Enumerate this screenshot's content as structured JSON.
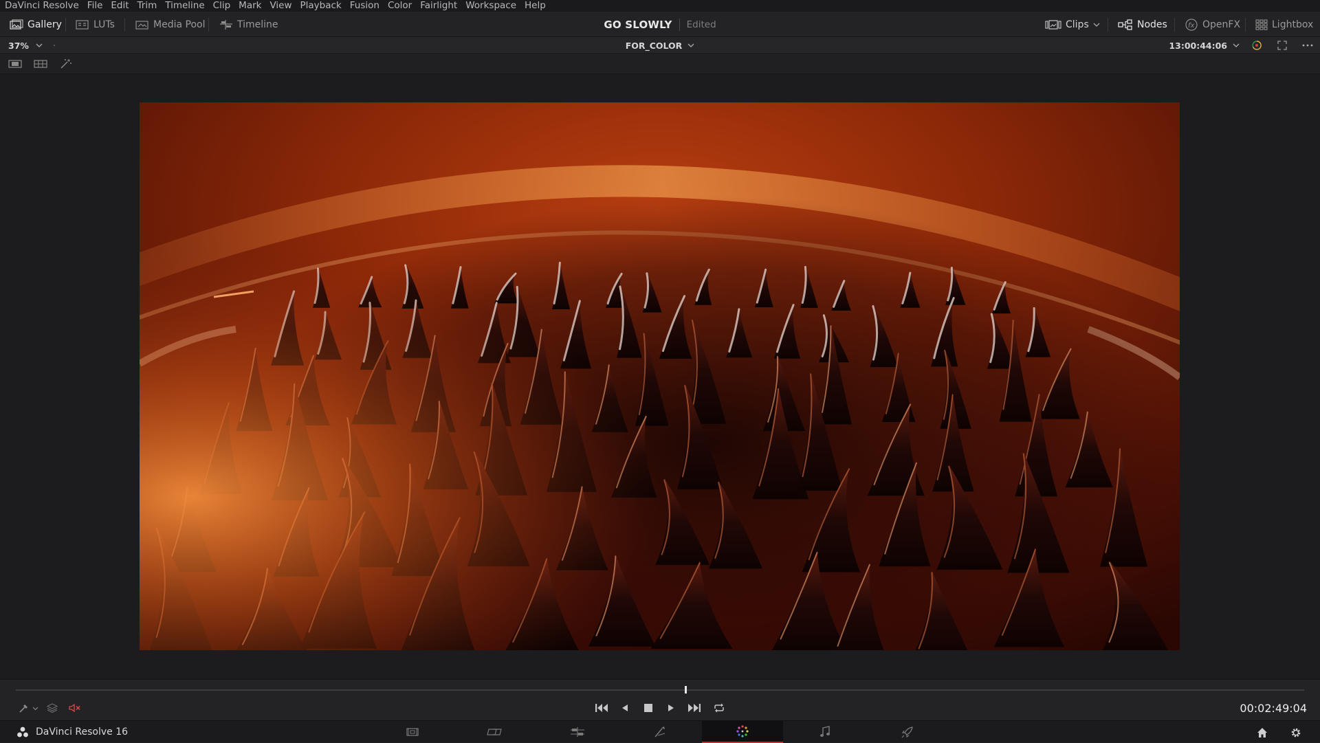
{
  "menu": [
    "DaVinci Resolve",
    "File",
    "Edit",
    "Trim",
    "Timeline",
    "Clip",
    "Mark",
    "View",
    "Playback",
    "Fusion",
    "Color",
    "Fairlight",
    "Workspace",
    "Help"
  ],
  "toolbar": {
    "gallery": "Gallery",
    "luts": "LUTs",
    "media_pool": "Media Pool",
    "timeline": "Timeline",
    "project_title": "GO SLOWLY",
    "project_status": "Edited",
    "clips": "Clips",
    "nodes": "Nodes",
    "openfx": "OpenFX",
    "lightbox": "Lightbox"
  },
  "viewer": {
    "zoom": "37%",
    "timeline_name": "FOR_COLOR",
    "timecode": "13:00:44:06",
    "playhead_fraction": 0.52
  },
  "transport": {
    "timecode": "00:02:49:04"
  },
  "pagebar": {
    "app_name": "DaVinci Resolve 16",
    "pages": [
      "media-page",
      "cut-page",
      "edit-page",
      "fusion-page",
      "color-page",
      "fairlight-page",
      "deliver-page"
    ],
    "active_page": "color-page"
  },
  "colors": {
    "accent_red": "#d8262b",
    "mute_red": "#e04848"
  }
}
